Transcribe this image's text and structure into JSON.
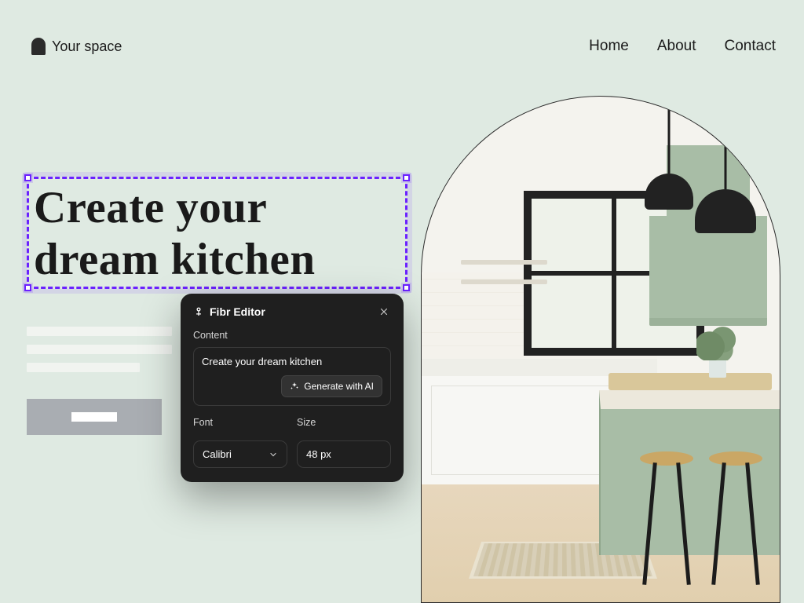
{
  "brand": {
    "name": "Your space"
  },
  "nav": {
    "items": [
      {
        "label": "Home"
      },
      {
        "label": "About"
      },
      {
        "label": "Contact"
      }
    ]
  },
  "hero": {
    "heading": "Create your dream kitchen"
  },
  "editor": {
    "title": "Fibr Editor",
    "content_label": "Content",
    "content_value": "Create your dream kitchen",
    "generate_label": "Generate with AI",
    "font_label": "Font",
    "font_value": "Calibri",
    "size_label": "Size",
    "size_value": "48 px"
  },
  "colors": {
    "page_bg": "#dfeae2",
    "selection_border": "#6b21ff",
    "editor_bg": "#1f1f1f",
    "sage": "#a8bda6"
  }
}
